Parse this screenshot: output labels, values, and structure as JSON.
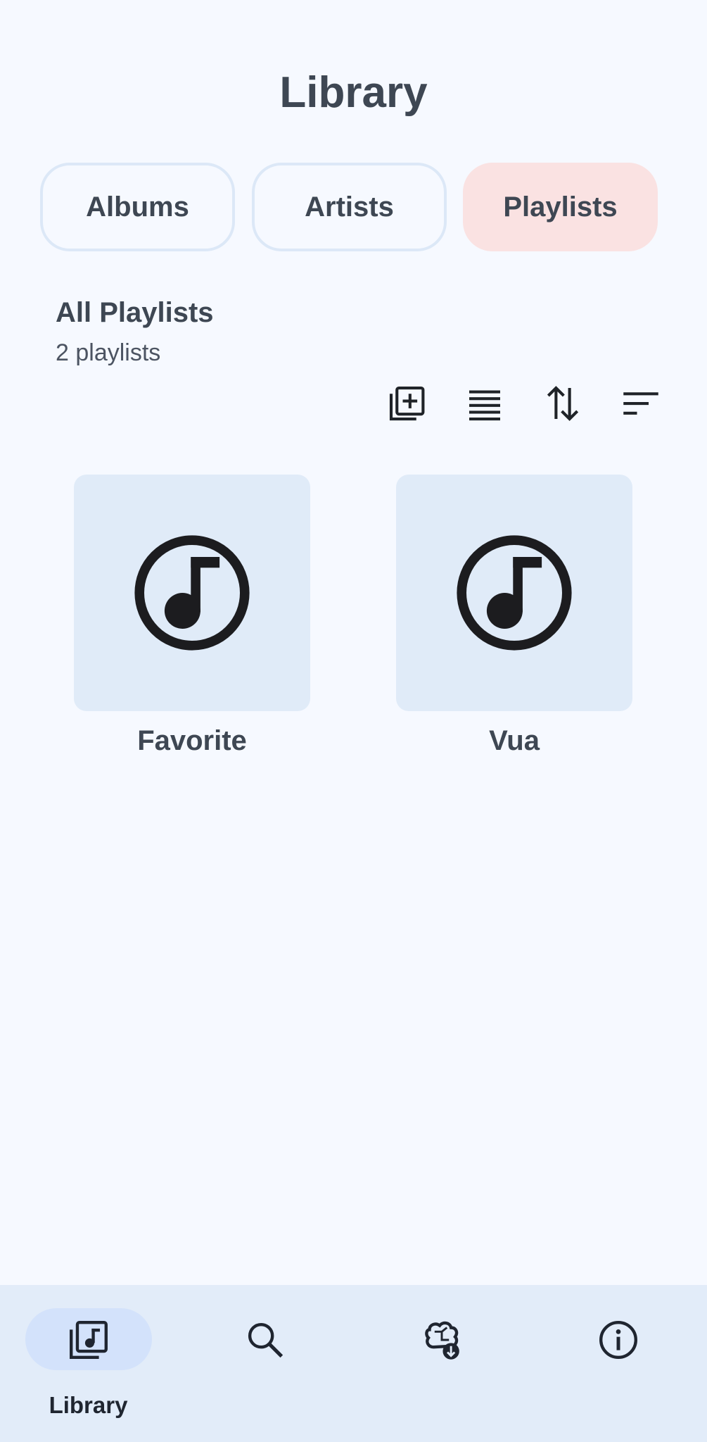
{
  "header": {
    "title": "Library"
  },
  "tabs": [
    {
      "label": "Albums",
      "selected": false
    },
    {
      "label": "Artists",
      "selected": false
    },
    {
      "label": "Playlists",
      "selected": true
    }
  ],
  "section": {
    "title": "All Playlists",
    "count": "2 playlists"
  },
  "toolbar": {
    "icons": [
      "add-playlist-icon",
      "list-view-icon",
      "sort-order-icon",
      "sort-filter-icon"
    ]
  },
  "playlists": [
    {
      "name": "Favorite",
      "icon": "music-note-icon"
    },
    {
      "name": "Vua",
      "icon": "music-note-icon"
    }
  ],
  "bottom_nav": {
    "items": [
      {
        "label": "Library",
        "icon": "library-music-icon",
        "active": true
      },
      {
        "icon": "search-icon",
        "active": false
      },
      {
        "icon": "ai-download-icon",
        "active": false
      },
      {
        "icon": "info-icon",
        "active": false
      }
    ]
  },
  "colors": {
    "background": "#f6f9ff",
    "selected_tab": "#fae2e2",
    "tile": "#e0ebf8",
    "nav_bar": "#e2ecf9",
    "nav_active_pill": "#d3e2fb"
  }
}
